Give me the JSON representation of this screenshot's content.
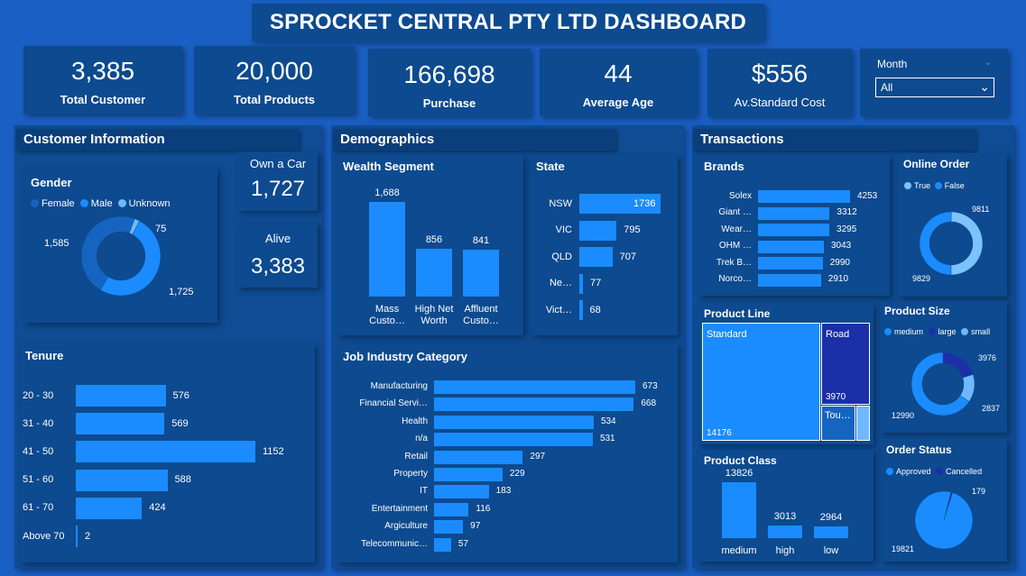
{
  "title": "SPROCKET CENTRAL PTY LTD DASHBOARD",
  "kpis": [
    {
      "value": "3,385",
      "label": "Total Customer"
    },
    {
      "value": "20,000",
      "label": "Total Products"
    },
    {
      "value": "166,698",
      "label": "Purchase"
    },
    {
      "value": "44",
      "label": "Average Age"
    },
    {
      "value": "$556",
      "label": "Av.Standard Cost"
    }
  ],
  "filter": {
    "label": "Month",
    "selected": "All"
  },
  "customer_info": {
    "header": "Customer Information",
    "gender": {
      "title": "Gender",
      "legend": [
        "Female",
        "Male",
        "Unknown"
      ],
      "values": [
        1585,
        1725,
        75
      ],
      "labels": [
        "1,585",
        "1,725",
        "75"
      ],
      "colors": [
        "#1565c0",
        "#1a8cff",
        "#6fb8ff"
      ]
    },
    "own_car": {
      "label": "Own a Car",
      "value": "1,727"
    },
    "alive": {
      "label": "Alive",
      "value": "3,383"
    },
    "tenure": {
      "title": "Tenure",
      "categories": [
        "20 - 30",
        "31 - 40",
        "41 - 50",
        "51 - 60",
        "61 - 70",
        "Above 70"
      ],
      "values": [
        576,
        569,
        1152,
        588,
        424,
        2
      ]
    }
  },
  "demographics": {
    "header": "Demographics",
    "wealth": {
      "title": "Wealth Segment",
      "categories": [
        "Mass Custo…",
        "High Net Worth",
        "Affluent Custo…"
      ],
      "values": [
        1688,
        856,
        841
      ],
      "value_labels": [
        "1,688",
        "856",
        "841"
      ]
    },
    "state": {
      "title": "State",
      "categories": [
        "NSW",
        "VIC",
        "QLD",
        "Ne…",
        "Vict…"
      ],
      "values": [
        1736,
        795,
        707,
        77,
        68
      ]
    },
    "job": {
      "title": "Job Industry Category",
      "categories": [
        "Manufacturing",
        "Financial Servi…",
        "Health",
        "n/a",
        "Retail",
        "Property",
        "IT",
        "Entertainment",
        "Argiculture",
        "Telecommunic…"
      ],
      "values": [
        673,
        668,
        534,
        531,
        297,
        229,
        183,
        116,
        97,
        57
      ]
    }
  },
  "transactions": {
    "header": "Transactions",
    "brands": {
      "title": "Brands",
      "categories": [
        "Solex",
        "Giant …",
        "Wear…",
        "OHM …",
        "Trek B…",
        "Norco…"
      ],
      "values": [
        4253,
        3312,
        3295,
        3043,
        2990,
        2910
      ]
    },
    "online_order": {
      "title": "Online Order",
      "legend": [
        "True",
        "False"
      ],
      "values": [
        9811,
        9829
      ],
      "labels": [
        "9811",
        "9829"
      ],
      "colors": [
        "#7cc2ff",
        "#1a8cff"
      ]
    },
    "product_line": {
      "title": "Product Line",
      "tiles": [
        {
          "name": "Standard",
          "value": "14176"
        },
        {
          "name": "Road",
          "value": "3970"
        },
        {
          "name": "Tou…",
          "value": ""
        }
      ]
    },
    "product_size": {
      "title": "Product Size",
      "legend": [
        "medium",
        "large",
        "small"
      ],
      "values": [
        12990,
        3976,
        2837
      ],
      "labels": [
        "12990",
        "3976",
        "2837"
      ],
      "colors": [
        "#1a8cff",
        "#1a2fa8",
        "#6fb8ff"
      ]
    },
    "product_class": {
      "title": "Product Class",
      "categories": [
        "medium",
        "high",
        "low"
      ],
      "values": [
        13826,
        3013,
        2964
      ]
    },
    "order_status": {
      "title": "Order Status",
      "legend": [
        "Approved",
        "Cancelled"
      ],
      "values": [
        19821,
        179
      ],
      "labels": [
        "19821",
        "179"
      ],
      "colors": [
        "#1a8cff",
        "#1a2fa8"
      ]
    }
  }
}
